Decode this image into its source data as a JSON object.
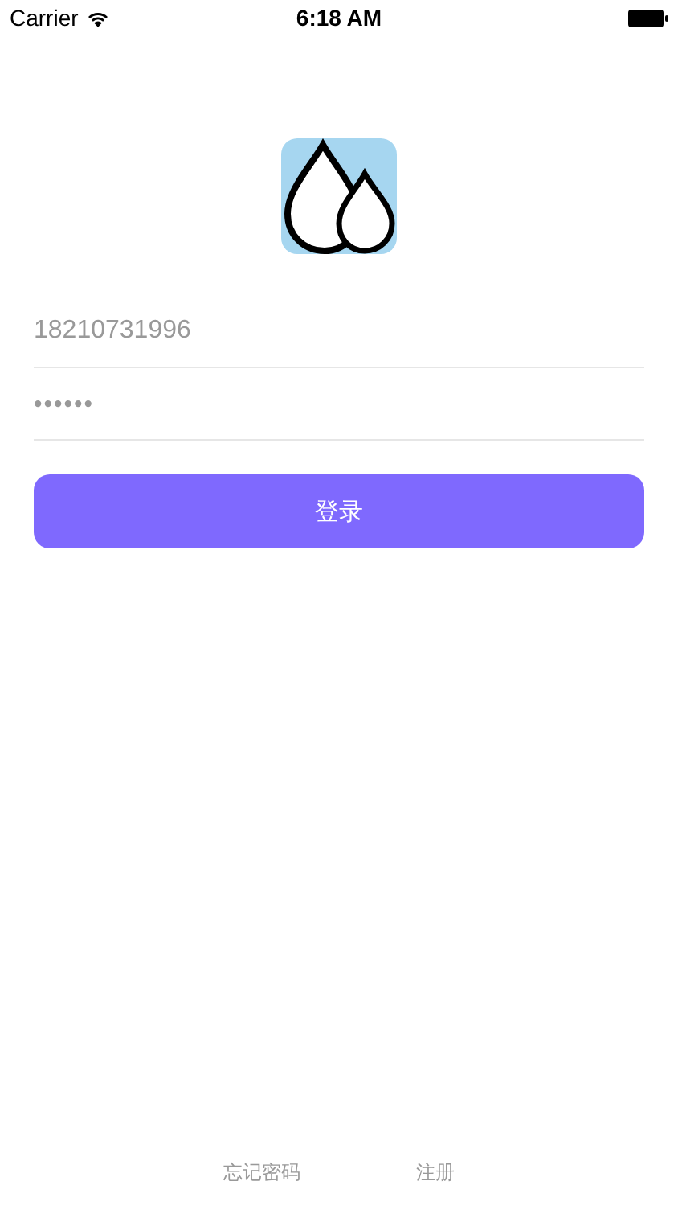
{
  "status_bar": {
    "carrier": "Carrier",
    "time": "6:18 AM"
  },
  "login_form": {
    "phone": {
      "value": "18210731996"
    },
    "password": {
      "value": "••••••"
    },
    "login_button": "登录"
  },
  "footer_links": [
    "忘记密码",
    "注册"
  ]
}
